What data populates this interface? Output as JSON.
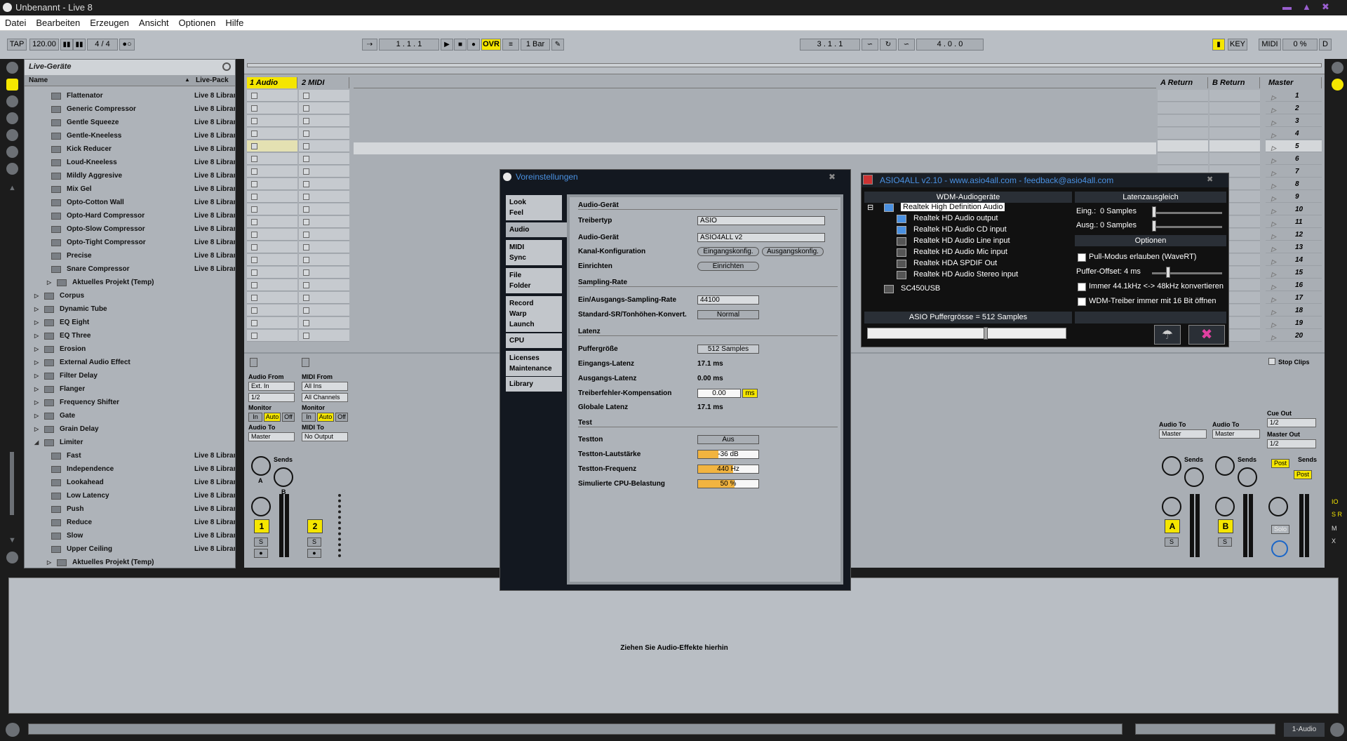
{
  "window": {
    "title": "Unbenannt - Live 8"
  },
  "menu": [
    "Datei",
    "Bearbeiten",
    "Erzeugen",
    "Ansicht",
    "Optionen",
    "Hilfe"
  ],
  "transport": {
    "tap": "TAP",
    "tempo": "120.00",
    "signature": "4 / 4",
    "position": "1 .   1 .   1",
    "ovr": "OVR",
    "quantize": "1 Bar",
    "loop_start": "3 .   1 .   1",
    "loop_length": "4 .   0 .   0",
    "key": "KEY",
    "midi": "MIDI",
    "cpu": "0 %",
    "d": "D"
  },
  "browser": {
    "title": "Live-Geräte",
    "col_name": "Name",
    "col_pack": "Live-Pack",
    "rows": [
      {
        "name": "Flattenator",
        "pack": "Live 8 Library",
        "type": "preset"
      },
      {
        "name": "Generic Compressor",
        "pack": "Live 8 Library",
        "type": "preset"
      },
      {
        "name": "Gentle Squeeze",
        "pack": "Live 8 Library",
        "type": "preset"
      },
      {
        "name": "Gentle-Kneeless",
        "pack": "Live 8 Library",
        "type": "preset"
      },
      {
        "name": "Kick Reducer",
        "pack": "Live 8 Library",
        "type": "preset"
      },
      {
        "name": "Loud-Kneeless",
        "pack": "Live 8 Library",
        "type": "preset"
      },
      {
        "name": "Mildly Aggresive",
        "pack": "Live 8 Library",
        "type": "preset"
      },
      {
        "name": "Mix Gel",
        "pack": "Live 8 Library",
        "type": "preset"
      },
      {
        "name": "Opto-Cotton Wall",
        "pack": "Live 8 Library",
        "type": "preset"
      },
      {
        "name": "Opto-Hard Compressor",
        "pack": "Live 8 Library",
        "type": "preset"
      },
      {
        "name": "Opto-Slow Compressor",
        "pack": "Live 8 Library",
        "type": "preset"
      },
      {
        "name": "Opto-Tight Compressor",
        "pack": "Live 8 Library",
        "type": "preset"
      },
      {
        "name": "Precise",
        "pack": "Live 8 Library",
        "type": "preset"
      },
      {
        "name": "Snare Compressor",
        "pack": "Live 8 Library",
        "type": "preset"
      },
      {
        "name": "Aktuelles Projekt (Temp)",
        "pack": "",
        "type": "sub"
      },
      {
        "name": "Corpus",
        "pack": "",
        "type": "device"
      },
      {
        "name": "Dynamic Tube",
        "pack": "",
        "type": "device"
      },
      {
        "name": "EQ Eight",
        "pack": "",
        "type": "device"
      },
      {
        "name": "EQ Three",
        "pack": "",
        "type": "device"
      },
      {
        "name": "Erosion",
        "pack": "",
        "type": "device"
      },
      {
        "name": "External Audio Effect",
        "pack": "",
        "type": "device"
      },
      {
        "name": "Filter Delay",
        "pack": "",
        "type": "device"
      },
      {
        "name": "Flanger",
        "pack": "",
        "type": "device"
      },
      {
        "name": "Frequency Shifter",
        "pack": "",
        "type": "device"
      },
      {
        "name": "Gate",
        "pack": "",
        "type": "device"
      },
      {
        "name": "Grain Delay",
        "pack": "",
        "type": "device"
      },
      {
        "name": "Limiter",
        "pack": "",
        "type": "open"
      },
      {
        "name": "Fast",
        "pack": "Live 8 Library",
        "type": "preset"
      },
      {
        "name": "Independence",
        "pack": "Live 8 Library",
        "type": "preset"
      },
      {
        "name": "Lookahead",
        "pack": "Live 8 Library",
        "type": "preset"
      },
      {
        "name": "Low Latency",
        "pack": "Live 8 Library",
        "type": "preset"
      },
      {
        "name": "Push",
        "pack": "Live 8 Library",
        "type": "preset"
      },
      {
        "name": "Reduce",
        "pack": "Live 8 Library",
        "type": "preset"
      },
      {
        "name": "Slow",
        "pack": "Live 8 Library",
        "type": "preset"
      },
      {
        "name": "Upper Ceiling",
        "pack": "Live 8 Library",
        "type": "preset"
      },
      {
        "name": "Aktuelles Projekt (Temp)",
        "pack": "",
        "type": "sub"
      }
    ]
  },
  "tracks": {
    "audio": "1 Audio",
    "midi": "2 MIDI",
    "return_a": "A Return",
    "return_b": "B Return",
    "master": "Master",
    "scenes": [
      "1",
      "2",
      "3",
      "4",
      "5",
      "6",
      "7",
      "8",
      "9",
      "10",
      "11",
      "12",
      "13",
      "14",
      "15",
      "16",
      "17",
      "18",
      "19",
      "20"
    ],
    "stop_clips": "Stop Clips",
    "audio_from": "Audio From",
    "audio_from_val": "Ext. In",
    "audio_ch": "1/2",
    "midi_from": "MIDI From",
    "midi_from_val": "All Ins",
    "midi_ch": "All Channels",
    "monitor": "Monitor",
    "mon_in": "In",
    "mon_auto": "Auto",
    "mon_off": "Off",
    "audio_to": "Audio To",
    "audio_to_val": "Master",
    "midi_to": "MIDI To",
    "midi_to_val": "No Output",
    "sends": "Sends",
    "send_a": "A",
    "send_b": "B",
    "num1": "1",
    "num2": "2",
    "solo": "S",
    "num_a": "A",
    "num_b": "B",
    "cue_out": "Cue Out",
    "cue_val": "1/2",
    "master_out": "Master Out",
    "master_val": "1/2",
    "post": "Post",
    "solo_label": "Solo"
  },
  "devices": {
    "drop_hint": "Ziehen Sie Audio-Effekte hierhin",
    "status_track": "1-Audio"
  },
  "prefs": {
    "title": "Voreinstellungen",
    "tabs": [
      "Look\nFeel",
      "Audio",
      "MIDI\nSync",
      "File\nFolder",
      "Record\nWarp\nLaunch",
      "CPU",
      "Licenses\nMaintenance",
      "Library"
    ],
    "audio_device_section": "Audio-Gerät",
    "driver_type": "Treibertyp",
    "driver_type_val": "ASIO",
    "audio_device": "Audio-Gerät",
    "audio_device_val": "ASIO4ALL v2",
    "channel_config": "Kanal-Konfiguration",
    "input_config": "Eingangskonfig.",
    "output_config": "Ausgangskonfig.",
    "setup": "Einrichten",
    "setup_btn": "Einrichten",
    "sampling_section": "Sampling-Rate",
    "sample_rate": "Ein/Ausgangs-Sampling-Rate",
    "sample_rate_val": "44100",
    "sr_conv": "Standard-SR/Tonhöhen-Konvert.",
    "sr_conv_val": "Normal",
    "latency_section": "Latenz",
    "buffer": "Puffergröße",
    "buffer_val": "512 Samples",
    "in_latency": "Eingangs-Latenz",
    "in_latency_val": "17.1 ms",
    "out_latency": "Ausgangs-Latenz",
    "out_latency_val": "0.00 ms",
    "driver_comp": "Treiberfehler-Kompensation",
    "driver_comp_val": "0.00",
    "driver_comp_unit": "ms",
    "global_latency": "Globale Latenz",
    "global_latency_val": "17.1 ms",
    "test_section": "Test",
    "test_tone": "Testton",
    "test_tone_val": "Aus",
    "test_volume": "Testton-Lautstärke",
    "test_volume_val": "-36",
    "test_volume_unit": "dB",
    "test_volume_level": 0.34,
    "test_freq": "Testton-Frequenz",
    "test_freq_val": "440",
    "test_freq_unit": "Hz",
    "test_freq_level": 0.58,
    "cpu_load": "Simulierte CPU-Belastung",
    "cpu_load_val": "50",
    "cpu_load_unit": "%",
    "cpu_load_level": 0.6
  },
  "asio": {
    "title": "ASIO4ALL v2.10 - www.asio4all.com - feedback@asio4all.com",
    "wdm_header": "WDM-Audiogeräte",
    "latency_header": "Latenzausgleich",
    "devices": [
      "Realtek High Definition Audio",
      "Realtek HD Audio output",
      "Realtek HD Audio CD input",
      "Realtek HD Audio Line input",
      "Realtek HD Audio Mic input",
      "Realtek HDA SPDIF Out",
      "Realtek HD Audio Stereo input",
      "SC450USB"
    ],
    "in_label": "Eing.:",
    "in_val": "0 Samples",
    "out_label": "Ausg.:",
    "out_val": "0 Samples",
    "options_header": "Optionen",
    "pull_mode": "Pull-Modus erlauben (WaveRT)",
    "buffer_offset": "Puffer-Offset: 4 ms",
    "always_convert": "Immer 44.1kHz <-> 48kHz konvertieren",
    "wdm_16bit": "WDM-Treiber immer mit 16 Bit öffnen",
    "buffer_size": "ASIO Puffergrösse = 512 Samples"
  }
}
